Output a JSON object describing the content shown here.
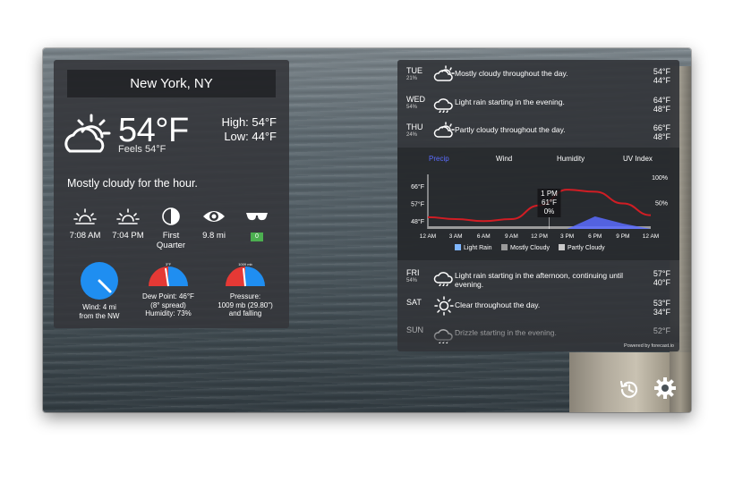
{
  "location": "New York, NY",
  "current": {
    "temp": "54°F",
    "feels": "Feels 54°F",
    "high": "High: 54°F",
    "low": "Low: 44°F",
    "summary": "Mostly cloudy for the hour.",
    "icon": "partly-cloudy-icon"
  },
  "stats": [
    {
      "name": "sunrise",
      "icon": "sunrise-icon",
      "label": "7:08 AM"
    },
    {
      "name": "sunset",
      "icon": "sunset-icon",
      "label": "7:04 PM"
    },
    {
      "name": "moon",
      "icon": "moon-half-icon",
      "label": "First Quarter"
    },
    {
      "name": "visibility",
      "icon": "eye-icon",
      "label": "9.8 mi"
    },
    {
      "name": "uv",
      "icon": "sunglasses-icon",
      "label": "0"
    }
  ],
  "dials": {
    "wind": {
      "label1": "Wind: 4 mi",
      "label2": "from the NW"
    },
    "dew": {
      "label1": "Dew Point: 46°F",
      "label2": "(8° spread)",
      "label3": "Humidity: 73%",
      "top": "3°F"
    },
    "pressure": {
      "label1": "Pressure:",
      "label2": "1009 mb (29.80\")",
      "label3": "and falling",
      "top": "1009 mb"
    }
  },
  "forecast_top": [
    {
      "day": "TUE",
      "pct": "21%",
      "icon": "partly-cloudy-icon",
      "text": "Mostly cloudy throughout the day.",
      "hi": "54°F",
      "lo": "44°F"
    },
    {
      "day": "WED",
      "pct": "54%",
      "icon": "rain-icon",
      "text": "Light rain starting in the evening.",
      "hi": "64°F",
      "lo": "48°F"
    },
    {
      "day": "THU",
      "pct": "24%",
      "icon": "partly-cloudy-icon",
      "text": "Partly cloudy throughout the day.",
      "hi": "66°F",
      "lo": "48°F"
    }
  ],
  "forecast_bottom": [
    {
      "day": "FRI",
      "pct": "54%",
      "icon": "rain-icon",
      "text": "Light rain starting in the afternoon, continuing until evening.",
      "hi": "57°F",
      "lo": "40°F"
    },
    {
      "day": "SAT",
      "pct": "",
      "icon": "sun-icon",
      "text": "Clear throughout the day.",
      "hi": "53°F",
      "lo": "34°F"
    },
    {
      "day": "SUN",
      "pct": "",
      "icon": "drizzle-icon",
      "text": "Drizzle starting in the evening.",
      "hi": "52°F",
      "lo": ""
    }
  ],
  "chart": {
    "tabs": [
      "Precip",
      "Wind",
      "Humidity",
      "UV Index"
    ],
    "active_tab": "Precip",
    "y_left": [
      "66°F",
      "57°F",
      "48°F"
    ],
    "y_right": [
      "100%",
      "50%"
    ],
    "x_labels": [
      "12 AM",
      "3 AM",
      "6 AM",
      "9 AM",
      "12 PM",
      "3 PM",
      "6 PM",
      "9 PM",
      "12 AM"
    ],
    "tooltip": [
      "1 PM",
      "61°F",
      "0%"
    ],
    "legend": [
      {
        "label": "Light Rain",
        "color": "#7fb6ff"
      },
      {
        "label": "Mostly Cloudy",
        "color": "#9a9a9a"
      },
      {
        "label": "Partly Cloudy",
        "color": "#c9c9c9"
      }
    ],
    "powered": "Powered by forecast.io"
  },
  "chart_data": {
    "type": "line",
    "x": [
      "12 AM",
      "3 AM",
      "6 AM",
      "9 AM",
      "12 PM",
      "3 PM",
      "6 PM",
      "9 PM",
      "12 AM"
    ],
    "series": [
      {
        "name": "",
        "values": [
          50,
          49,
          48,
          49,
          56,
          64,
          63,
          57,
          51
        ],
        "color": "#d11d24"
      }
    ],
    "precip": [
      0,
      0,
      0,
      0,
      0,
      0,
      28,
      12,
      0
    ],
    "ylim": [
      44,
      70
    ]
  },
  "colors": {
    "accent": "#5a6cff",
    "temp_line": "#d11d24",
    "wind_dial": "#1f8ef1"
  }
}
